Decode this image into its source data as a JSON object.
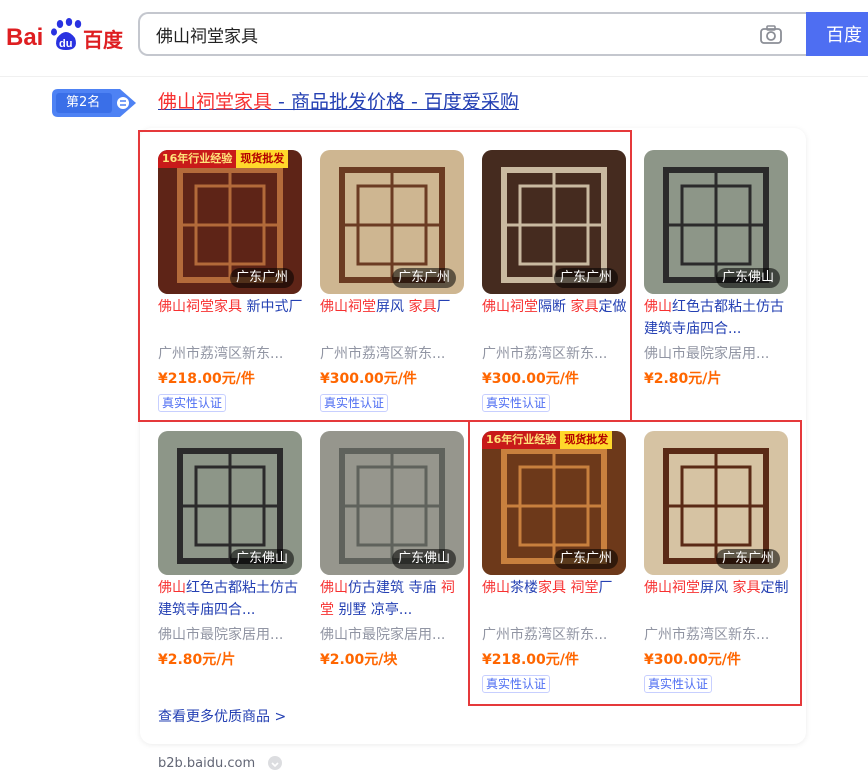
{
  "search": {
    "query": "佛山祠堂家具",
    "button_label": "百度"
  },
  "logo": {
    "left_text": "Bai",
    "paw_text": "du",
    "right_text": "百度"
  },
  "result": {
    "rank": "第2名",
    "title_highlight": "佛山祠堂家具",
    "title_rest": " - 商品批发价格 - 百度爱采购"
  },
  "items": [
    {
      "region": "广东广州",
      "banner_left": "16年行业经验",
      "banner_right": "现货批发",
      "title_parts": [
        {
          "t": "佛山祠堂家具",
          "h": true
        },
        {
          "t": " 新中式厂",
          "h": false
        }
      ],
      "address": "广州市荔湾区新东...",
      "price": "¥218.00元/件",
      "badge": "真实性认证"
    },
    {
      "region": "广东广州",
      "banner_left": "",
      "banner_right": "",
      "title_parts": [
        {
          "t": "佛山祠堂",
          "h": true
        },
        {
          "t": "屏风 ",
          "h": false
        },
        {
          "t": "家具",
          "h": true
        },
        {
          "t": "厂",
          "h": false
        }
      ],
      "address": "广州市荔湾区新东...",
      "price": "¥300.00元/件",
      "badge": "真实性认证"
    },
    {
      "region": "广东广州",
      "banner_left": "",
      "banner_right": "",
      "title_parts": [
        {
          "t": "佛山祠堂",
          "h": true
        },
        {
          "t": "隔断 ",
          "h": false
        },
        {
          "t": "家具",
          "h": true
        },
        {
          "t": "定做",
          "h": false
        }
      ],
      "address": "广州市荔湾区新东...",
      "price": "¥300.00元/件",
      "badge": "真实性认证"
    },
    {
      "region": "广东佛山",
      "banner_left": "",
      "banner_right": "",
      "title_parts": [
        {
          "t": "佛山",
          "h": true
        },
        {
          "t": "红色古都粘土仿古建筑寺庙四合...",
          "h": false
        }
      ],
      "address": "佛山市最院家居用...",
      "price": "¥2.80元/片",
      "badge": ""
    },
    {
      "region": "广东佛山",
      "banner_left": "",
      "banner_right": "",
      "title_parts": [
        {
          "t": "佛山",
          "h": true
        },
        {
          "t": "红色古都粘土仿古建筑寺庙四合...",
          "h": false
        }
      ],
      "address": "佛山市最院家居用...",
      "price": "¥2.80元/片",
      "badge": ""
    },
    {
      "region": "广东佛山",
      "banner_left": "",
      "banner_right": "",
      "title_parts": [
        {
          "t": "佛山",
          "h": true
        },
        {
          "t": "仿古建筑 寺庙 ",
          "h": false
        },
        {
          "t": "祠堂",
          "h": true
        },
        {
          "t": " 别墅 凉亭...",
          "h": false
        }
      ],
      "address": "佛山市最院家居用...",
      "price": "¥2.00元/块",
      "badge": ""
    },
    {
      "region": "广东广州",
      "banner_left": "16年行业经验",
      "banner_right": "现货批发",
      "title_parts": [
        {
          "t": "佛山",
          "h": true
        },
        {
          "t": "茶楼",
          "h": false
        },
        {
          "t": "家具",
          "h": true
        },
        {
          "t": " ",
          "h": false
        },
        {
          "t": "祠堂",
          "h": true
        },
        {
          "t": "厂",
          "h": false
        }
      ],
      "address": "广州市荔湾区新东...",
      "price": "¥218.00元/件",
      "badge": "真实性认证"
    },
    {
      "region": "广东广州",
      "banner_left": "",
      "banner_right": "",
      "title_parts": [
        {
          "t": "佛山祠堂",
          "h": true
        },
        {
          "t": "屏风 ",
          "h": false
        },
        {
          "t": "家具",
          "h": true
        },
        {
          "t": "定制",
          "h": false
        }
      ],
      "address": "广州市荔湾区新东...",
      "price": "¥300.00元/件",
      "badge": "真实性认证"
    }
  ],
  "more_link": "查看更多优质商品 >",
  "source": "b2b.baidu.com",
  "colors": {
    "accent": "#4e6ef2",
    "link": "#2440b3",
    "highlight": "#f73131",
    "price": "#ff6600",
    "outline": "#e5393b"
  },
  "icons": {
    "camera": "camera-icon",
    "rank": "rank-badge-icon",
    "source_menu": "chevron-down-icon"
  }
}
